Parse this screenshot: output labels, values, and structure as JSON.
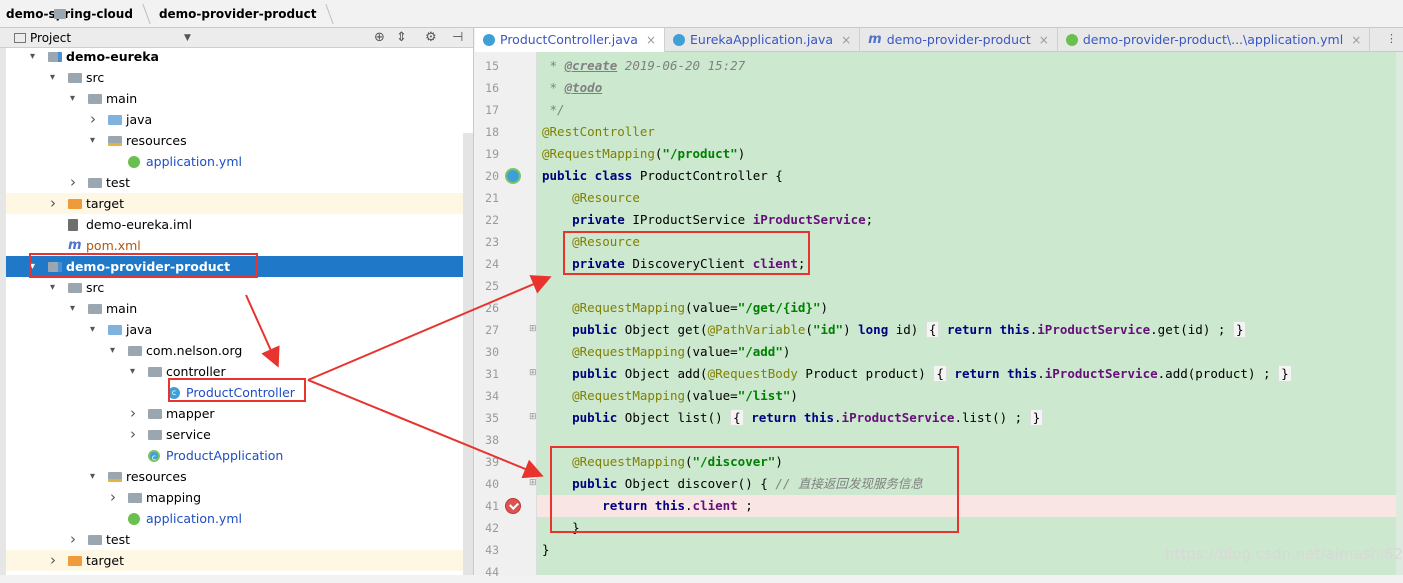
{
  "breadcrumb": [
    "demo-spring-cloud",
    "demo-provider-product"
  ],
  "project_panel": {
    "title": "Project",
    "toolbar_icons": [
      "target-icon",
      "collapse-icon",
      "gear-icon",
      "hide-icon"
    ]
  },
  "tree": [
    {
      "label": "demo-eureka",
      "depth": 1,
      "arrow": "open",
      "icon": "mod",
      "bold": true
    },
    {
      "label": "src",
      "depth": 2,
      "arrow": "open",
      "icon": "folder"
    },
    {
      "label": "main",
      "depth": 3,
      "arrow": "open",
      "icon": "folder"
    },
    {
      "label": "java",
      "depth": 4,
      "arrow": "closed",
      "icon": "blue"
    },
    {
      "label": "resources",
      "depth": 4,
      "arrow": "open",
      "icon": "res"
    },
    {
      "label": "application.yml",
      "depth": 5,
      "arrow": "",
      "icon": "spring",
      "color": "blue"
    },
    {
      "label": "test",
      "depth": 3,
      "arrow": "closed",
      "icon": "folder"
    },
    {
      "label": "target",
      "depth": 2,
      "arrow": "closed",
      "icon": "orange",
      "excluded": true
    },
    {
      "label": "demo-eureka.iml",
      "depth": 2,
      "arrow": "",
      "icon": "iml"
    },
    {
      "label": "pom.xml",
      "depth": 2,
      "arrow": "",
      "icon": "mvn",
      "color": "brown"
    },
    {
      "label": "demo-provider-product",
      "depth": 1,
      "arrow": "open",
      "icon": "mod",
      "selected": true
    },
    {
      "label": "src",
      "depth": 2,
      "arrow": "open",
      "icon": "folder"
    },
    {
      "label": "main",
      "depth": 3,
      "arrow": "open",
      "icon": "folder"
    },
    {
      "label": "java",
      "depth": 4,
      "arrow": "open",
      "icon": "blue"
    },
    {
      "label": "com.nelson.org",
      "depth": 5,
      "arrow": "open",
      "icon": "pkg"
    },
    {
      "label": "controller",
      "depth": 6,
      "arrow": "open",
      "icon": "pkg"
    },
    {
      "label": "ProductController",
      "depth": 7,
      "arrow": "",
      "icon": "cls",
      "color": "blue"
    },
    {
      "label": "mapper",
      "depth": 6,
      "arrow": "closed",
      "icon": "pkg"
    },
    {
      "label": "service",
      "depth": 6,
      "arrow": "closed",
      "icon": "pkg"
    },
    {
      "label": "ProductApplication",
      "depth": 6,
      "arrow": "",
      "icon": "cls2",
      "color": "blue"
    },
    {
      "label": "resources",
      "depth": 4,
      "arrow": "open",
      "icon": "res"
    },
    {
      "label": "mapping",
      "depth": 5,
      "arrow": "closed",
      "icon": "folder"
    },
    {
      "label": "application.yml",
      "depth": 5,
      "arrow": "",
      "icon": "spring",
      "color": "blue"
    },
    {
      "label": "test",
      "depth": 3,
      "arrow": "closed",
      "icon": "folder"
    },
    {
      "label": "target",
      "depth": 2,
      "arrow": "closed",
      "icon": "orange",
      "excluded": true
    }
  ],
  "tabs": [
    {
      "label": "ProductController.java",
      "icon": "cls",
      "active": true
    },
    {
      "label": "EurekaApplication.java",
      "icon": "cls"
    },
    {
      "label": "demo-provider-product",
      "icon": "mvn"
    },
    {
      "label": "demo-provider-product\\...\\application.yml",
      "icon": "sp"
    }
  ],
  "tabs_menu": "⋮",
  "code_lines": [
    {
      "n": "15",
      "html": " <span class=\"cmt\">* </span><span class=\"tag\">@create</span><span class=\"cmt\"> 2019-06-20 15:27</span>"
    },
    {
      "n": "16",
      "html": " <span class=\"cmt\">* </span><span class=\"tag\">@todo</span>"
    },
    {
      "n": "17",
      "html": " <span class=\"cmt\">*/</span>"
    },
    {
      "n": "18",
      "html": "<span class=\"ann\">@RestController</span>"
    },
    {
      "n": "19",
      "html": "<span class=\"ann\">@RequestMapping</span>(<span class=\"str\">\"/product\"</span>)"
    },
    {
      "n": "20",
      "html": "<span class=\"k\">public class</span> ProductController {",
      "gicon": true
    },
    {
      "n": "21",
      "html": "    <span class=\"ann\">@Resource</span>"
    },
    {
      "n": "22",
      "html": "    <span class=\"k\">private</span> IProductService <span class=\"fld\">iProductService</span>;"
    },
    {
      "n": "23",
      "html": "    <span class=\"ann\">@Resource</span>"
    },
    {
      "n": "24",
      "html": "    <span class=\"k\">private</span> DiscoveryClient <span class=\"fld\">client</span>;"
    },
    {
      "n": "25",
      "html": ""
    },
    {
      "n": "26",
      "html": "    <span class=\"ann\">@RequestMapping</span>(value=<span class=\"str\">\"/get/{id}\"</span>)"
    },
    {
      "n": "27",
      "html": "    <span class=\"k\">public</span> Object get(<span class=\"ann\">@PathVariable</span>(<span class=\"str\">\"id\"</span>) <span class=\"k\">long</span> id) <span class=\"brk\">{</span> <span class=\"k\">return this</span>.<span class=\"fld\">iProductService</span>.get(id) ; <span class=\"brk\">}</span>",
      "fold": true
    },
    {
      "n": "30",
      "html": "    <span class=\"ann\">@RequestMapping</span>(value=<span class=\"str\">\"/add\"</span>)"
    },
    {
      "n": "31",
      "html": "    <span class=\"k\">public</span> Object add(<span class=\"ann\">@RequestBody</span> Product product) <span class=\"brk\">{</span> <span class=\"k\">return this</span>.<span class=\"fld\">iProductService</span>.add(product) ; <span class=\"brk\">}</span>",
      "fold": true
    },
    {
      "n": "34",
      "html": "    <span class=\"ann\">@RequestMapping</span>(value=<span class=\"str\">\"/list\"</span>)"
    },
    {
      "n": "35",
      "html": "    <span class=\"k\">public</span> Object list() <span class=\"brk\">{</span> <span class=\"k\">return this</span>.<span class=\"fld\">iProductService</span>.list() ; <span class=\"brk\">}</span>",
      "fold": true
    },
    {
      "n": "38",
      "html": ""
    },
    {
      "n": "39",
      "html": "    <span class=\"ann\">@RequestMapping</span>(<span class=\"str\">\"/discover\"</span>)"
    },
    {
      "n": "40",
      "html": "    <span class=\"k\">public</span> Object discover() { <span class=\"cmt\">// 直接返回发现服务信息</span>",
      "fold": true
    },
    {
      "n": "41",
      "html": "        <span class=\"k\">return this</span>.<span class=\"fld\">client</span> ;",
      "error": true
    },
    {
      "n": "42",
      "html": "    }"
    },
    {
      "n": "43",
      "html": "}"
    },
    {
      "n": "44",
      "html": ""
    }
  ],
  "watermark": "https://blog.csdn.net/aimashi620"
}
